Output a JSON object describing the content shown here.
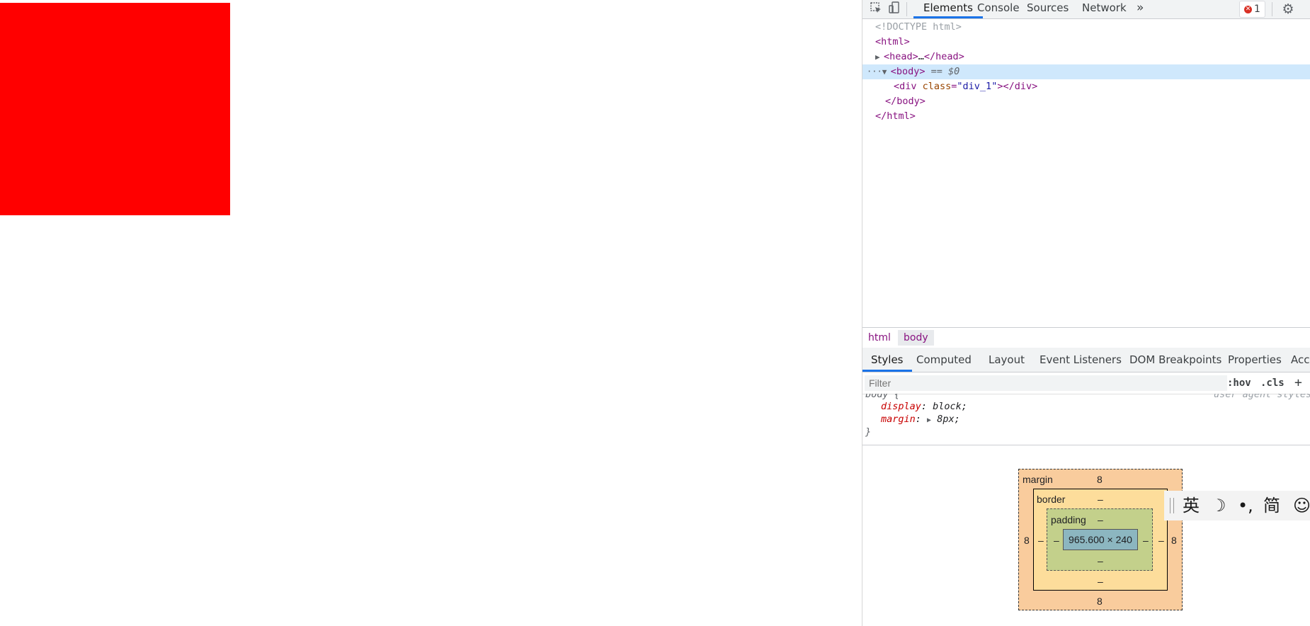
{
  "toolbar": {
    "tabs": [
      "Elements",
      "Console",
      "Sources",
      "Network"
    ],
    "more_label": "»",
    "error_count": "1"
  },
  "dom": {
    "doctype": "<!DOCTYPE html>",
    "html_open": "<html>",
    "head_open": "<head>",
    "head_ellipsis": "…",
    "head_close": "</head>",
    "body_open": "<body>",
    "body_marker": " == $0",
    "div_open": "<div ",
    "div_attr_name": "class",
    "div_attr_eq": "=",
    "div_attr_val": "\"div_1\"",
    "div_gt": ">",
    "div_close": "</div>",
    "body_close": "</body>",
    "html_close": "</html>",
    "ellipsis_dots": "···"
  },
  "breadcrumb": {
    "items": [
      "html",
      "body"
    ]
  },
  "panel_tabs": [
    "Styles",
    "Computed",
    "Layout",
    "Event Listeners",
    "DOM Breakpoints",
    "Properties",
    "Acces"
  ],
  "filter": {
    "placeholder": "Filter",
    "hov": ":hov",
    "cls": ".cls",
    "add": "+"
  },
  "styles": {
    "selector": "body {",
    "source": "user agent styles",
    "display_prop": "display",
    "display_val": "block;",
    "margin_prop": "margin",
    "margin_val": "8px;",
    "close": "}"
  },
  "box_model": {
    "margin_label": "margin",
    "margin_top": "8",
    "margin_left": "8",
    "margin_right": "8",
    "margin_bottom": "8",
    "border_label": "border",
    "border_top": "–",
    "border_left": "–",
    "border_right": "–",
    "border_bottom": "–",
    "padding_label": "padding",
    "padding_top": "–",
    "padding_left": "–",
    "padding_right": "–",
    "padding_bottom": "–",
    "content": "965.600 × 240"
  },
  "ime": {
    "items": [
      "英",
      "☽",
      "•,",
      "简",
      "☺"
    ]
  },
  "colors": {
    "red_box": "#ff0000",
    "accent": "#1a73e8",
    "selected_row": "#cfe8fc"
  }
}
